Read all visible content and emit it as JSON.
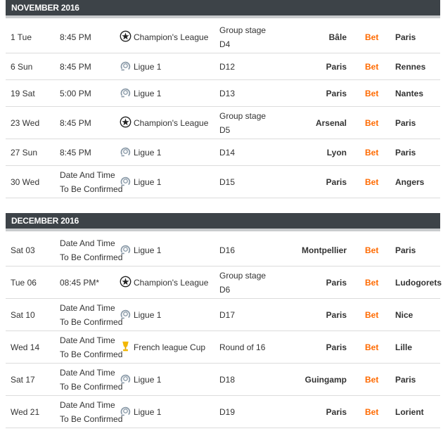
{
  "november": {
    "header": "NOVEMBER 2016",
    "rows": [
      {
        "date": "1 Tue",
        "time": "8:45 PM",
        "comp": "Champion's League",
        "icon": "champions-league-icon",
        "stage1": "Group stage",
        "stage2": "D4",
        "home": "Bâle",
        "bet": "Bet",
        "away": "Paris"
      },
      {
        "date": "6 Sun",
        "time": "8:45 PM",
        "comp": "Ligue 1",
        "icon": "ligue1-icon",
        "stage1": "D12",
        "stage2": "",
        "home": "Paris",
        "bet": "Bet",
        "away": "Rennes"
      },
      {
        "date": "19 Sat",
        "time": "5:00 PM",
        "comp": "Ligue 1",
        "icon": "ligue1-icon",
        "stage1": "D13",
        "stage2": "",
        "home": "Paris",
        "bet": "Bet",
        "away": "Nantes"
      },
      {
        "date": "23 Wed",
        "time": "8:45 PM",
        "comp": "Champion's League",
        "icon": "champions-league-icon",
        "stage1": "Group stage",
        "stage2": "D5",
        "home": "Arsenal",
        "bet": "Bet",
        "away": "Paris"
      },
      {
        "date": "27 Sun",
        "time": "8:45 PM",
        "comp": "Ligue 1",
        "icon": "ligue1-icon",
        "stage1": "D14",
        "stage2": "",
        "home": "Lyon",
        "bet": "Bet",
        "away": "Paris"
      },
      {
        "date": "30 Wed",
        "time": "Date And Time To Be Confirmed",
        "comp": "Ligue 1",
        "icon": "ligue1-icon",
        "stage1": "D15",
        "stage2": "",
        "home": "Paris",
        "bet": "Bet",
        "away": "Angers"
      }
    ]
  },
  "december": {
    "header": "DECEMBER 2016",
    "rows": [
      {
        "date": "Sat 03",
        "time": "Date And Time To Be Confirmed",
        "comp": "Ligue 1",
        "icon": "ligue1-icon",
        "stage1": "D16",
        "stage2": "",
        "home": "Montpellier",
        "bet": "Bet",
        "away": "Paris"
      },
      {
        "date": "Tue 06",
        "time": "08:45 PM*",
        "comp": "Champion's League",
        "icon": "champions-league-icon",
        "stage1": "Group stage",
        "stage2": "D6",
        "home": "Paris",
        "bet": "Bet",
        "away": "Ludogorets"
      },
      {
        "date": "Sat 10",
        "time": "Date And Time To Be Confirmed",
        "comp": "Ligue 1",
        "icon": "ligue1-icon",
        "stage1": "D17",
        "stage2": "",
        "home": "Paris",
        "bet": "Bet",
        "away": "Nice"
      },
      {
        "date": "Wed 14",
        "time": "Date And Time To Be Confirmed",
        "comp": "French league Cup",
        "icon": "league-cup-icon",
        "stage1": "Round of 16",
        "stage2": "",
        "home": "Paris",
        "bet": "Bet",
        "away": "Lille"
      },
      {
        "date": "Sat 17",
        "time": "Date And Time To Be Confirmed",
        "comp": "Ligue 1",
        "icon": "ligue1-icon",
        "stage1": "D18",
        "stage2": "",
        "home": "Guingamp",
        "bet": "Bet",
        "away": "Paris"
      },
      {
        "date": "Wed 21",
        "time": "Date And Time To Be Confirmed",
        "comp": "Ligue 1",
        "icon": "ligue1-icon",
        "stage1": "D19",
        "stage2": "",
        "home": "Paris",
        "bet": "Bet",
        "away": "Lorient"
      }
    ]
  },
  "colors": {
    "header_bg": "#3d4348",
    "bet": "#ff6a00",
    "cup": "#f2b705"
  }
}
